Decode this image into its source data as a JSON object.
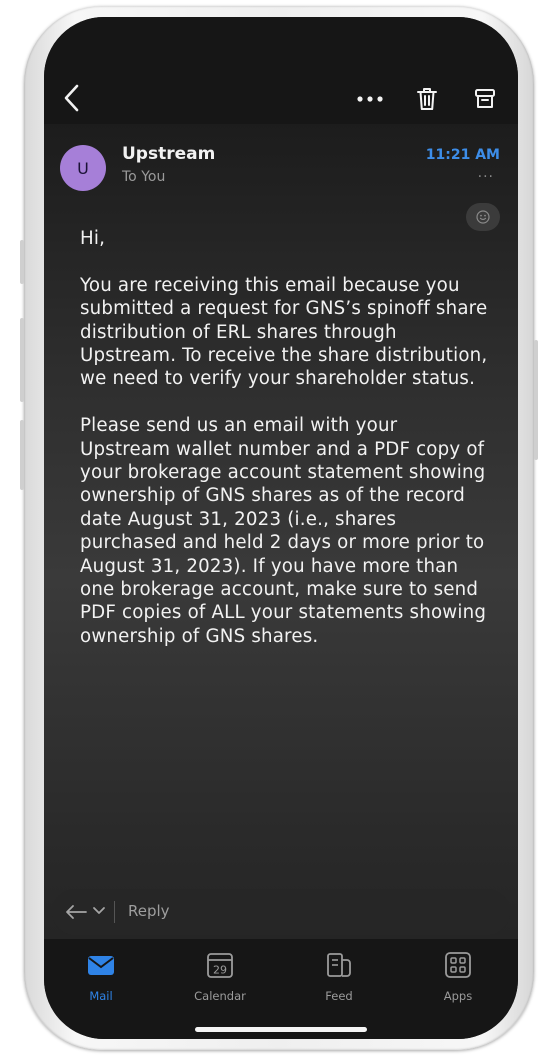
{
  "header": {
    "avatar_letter": "U",
    "sender": "Upstream",
    "recipient": "To You",
    "time": "11:21 AM",
    "more": "···"
  },
  "body": {
    "greeting": "Hi,",
    "paragraph1": "You are receiving this email because you submitted a request for GNS’s spinoff share distribution of ERL shares through Upstream. To receive the share distribution, we need to verify your shareholder status.",
    "paragraph2": "Please send us an email with your Upstream wallet number and a PDF copy of your brokerage account statement showing ownership of GNS shares as of the record date August 31, 2023 (i.e., shares purchased and held 2 days or more prior to August 31, 2023). If you have more than one brokerage account, make sure to send PDF copies of ALL your statements showing ownership of GNS shares."
  },
  "reply": {
    "label": "Reply"
  },
  "tabs": [
    {
      "label": "Mail",
      "icon": "mail-icon",
      "active": true
    },
    {
      "label": "Calendar",
      "icon": "calendar-icon",
      "date": "29",
      "active": false
    },
    {
      "label": "Feed",
      "icon": "feed-icon",
      "active": false
    },
    {
      "label": "Apps",
      "icon": "apps-icon",
      "active": false
    }
  ],
  "colors": {
    "accent": "#2f83e6",
    "time": "#3d8de8",
    "avatar": "#a67fd8",
    "background": "#161616"
  }
}
